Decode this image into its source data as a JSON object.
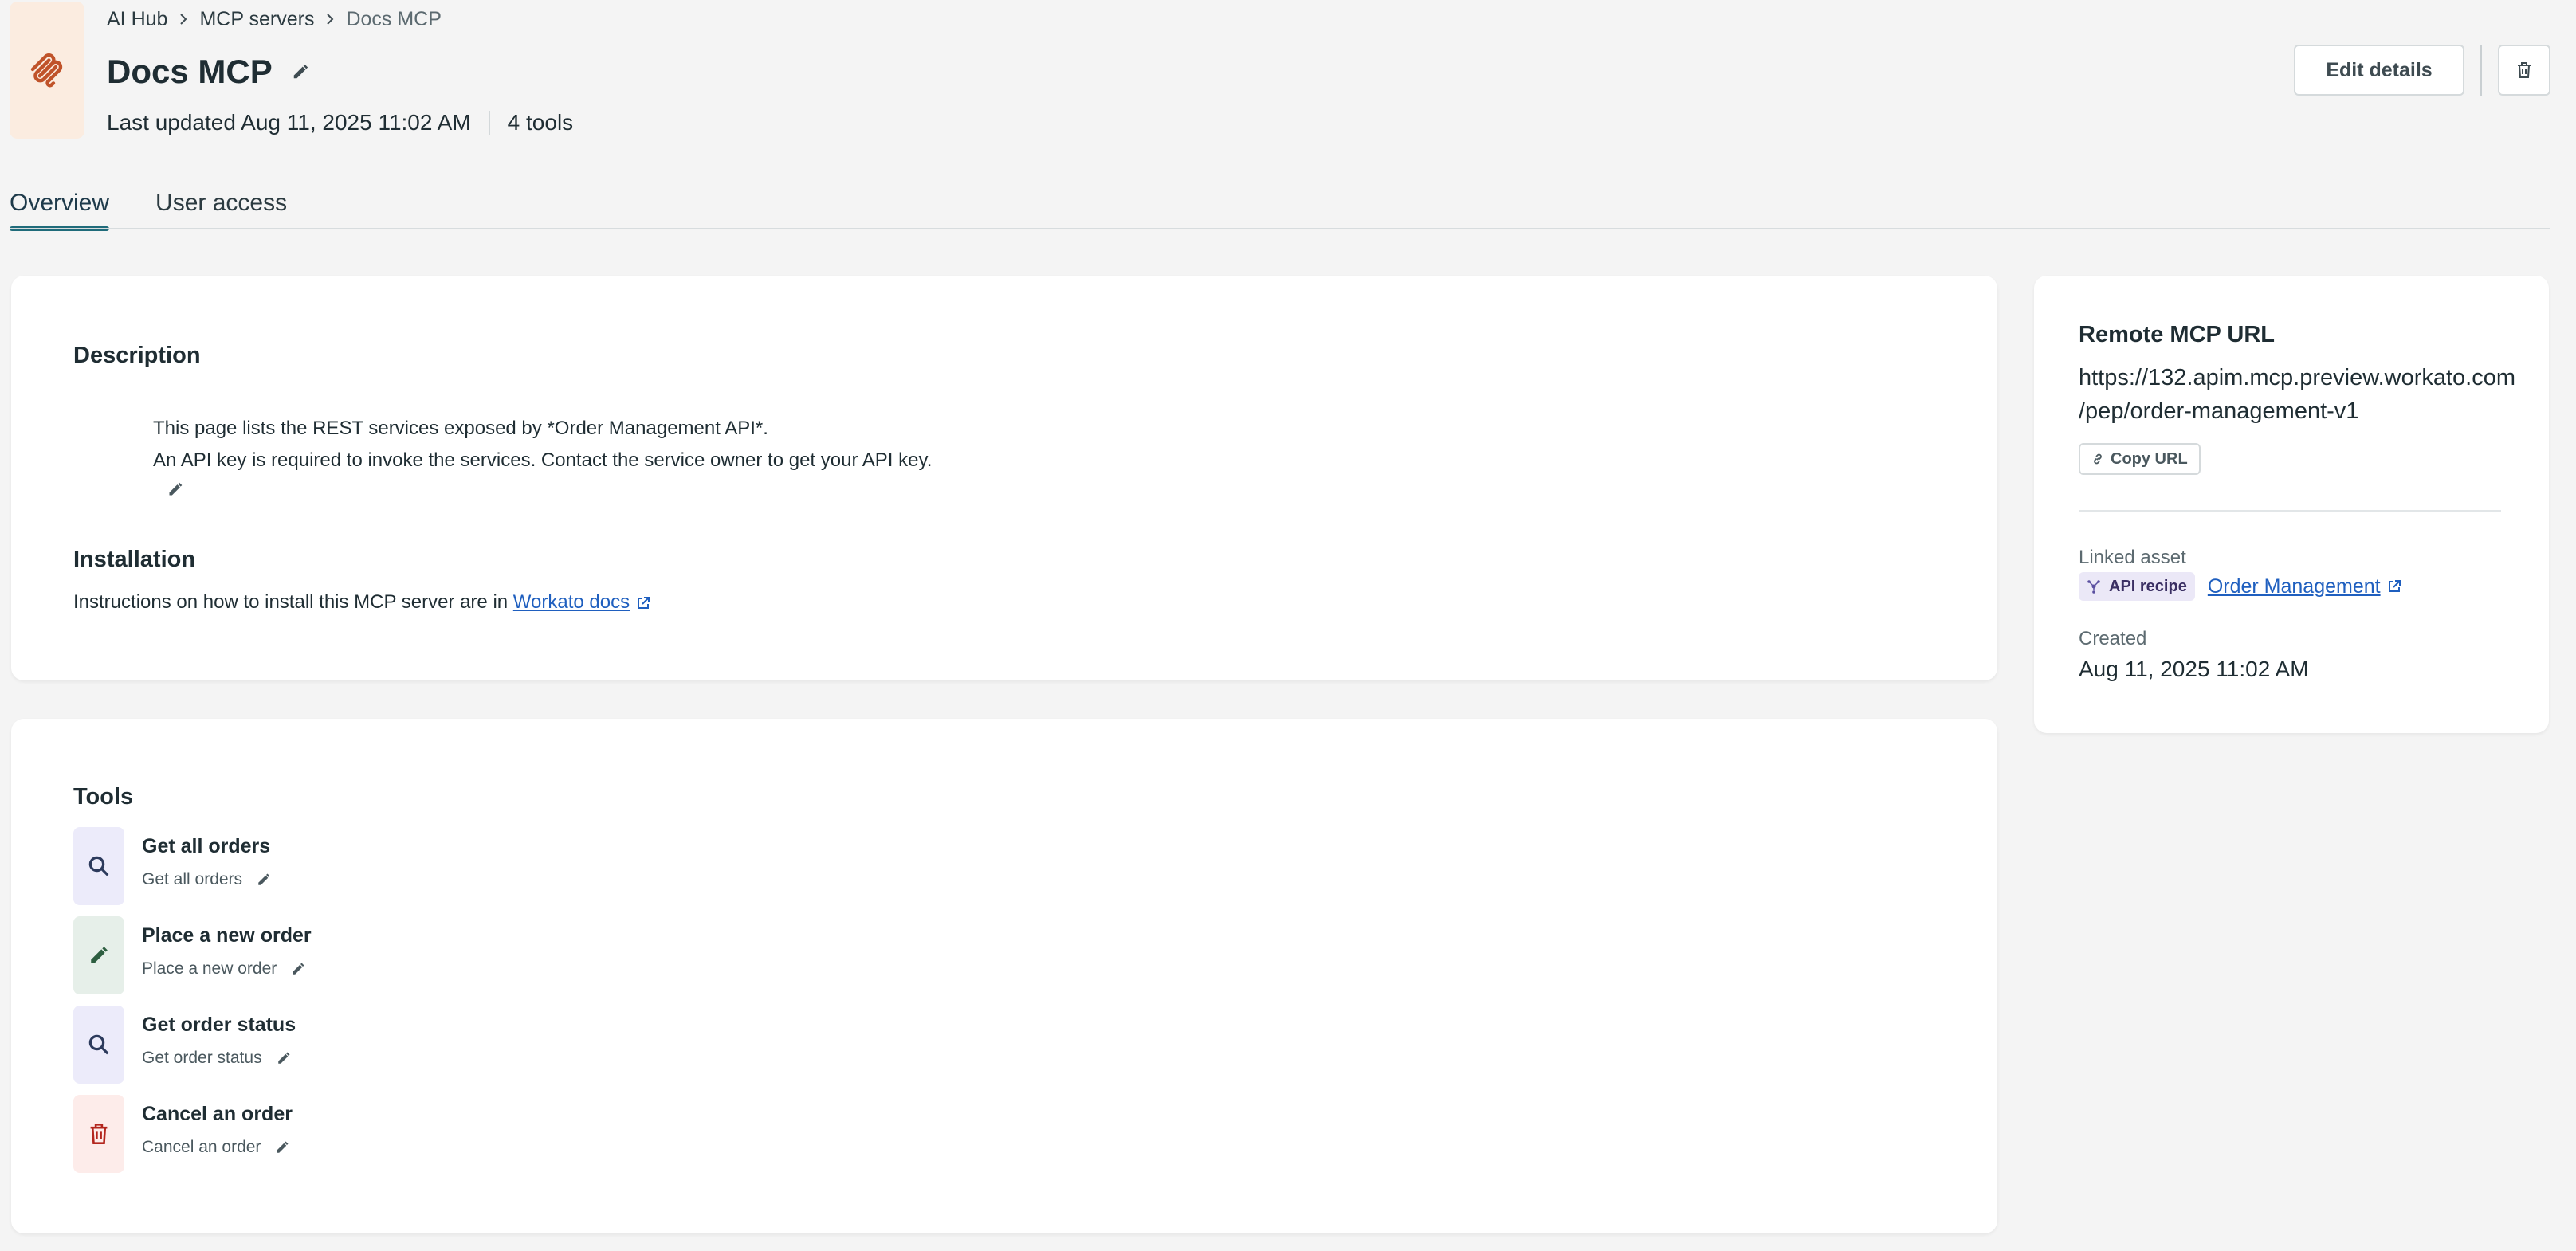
{
  "breadcrumb": {
    "item1": "AI Hub",
    "item2": "MCP servers",
    "current": "Docs MCP"
  },
  "page": {
    "title": "Docs MCP",
    "last_updated": "Last updated Aug 11, 2025 11:02 AM",
    "tools_count": "4 tools",
    "icon": "mcp-icon",
    "icon_color": "#c0532a"
  },
  "actions": {
    "edit_label": "Edit details",
    "delete_icon": "trash-icon"
  },
  "tabs": [
    {
      "label": "Overview",
      "active": true
    },
    {
      "label": "User access",
      "active": false
    }
  ],
  "overview": {
    "description_heading": "Description",
    "description_lines": [
      "This page lists the REST services exposed by *Order Management API*.",
      "An API key is required to invoke the services. Contact the service owner to get your API key."
    ],
    "installation_heading": "Installation",
    "installation_text": "Instructions on how to install this MCP server are in",
    "installation_link": "Workato docs"
  },
  "tools": {
    "heading": "Tools",
    "items": [
      {
        "name": "Get all orders",
        "description": "Get all orders",
        "icon": "search-icon",
        "color": "#ecebfa"
      },
      {
        "name": "Place a new order",
        "description": "Place a new order",
        "icon": "pencil-icon",
        "color": "#e6efe9"
      },
      {
        "name": "Get order status",
        "description": "Get order status",
        "icon": "search-icon",
        "color": "#ecebfa"
      },
      {
        "name": "Cancel an order",
        "description": "Cancel an order",
        "icon": "trash-icon",
        "color": "#fdecea"
      }
    ]
  },
  "side": {
    "url_heading": "Remote MCP URL",
    "url_line1": "https://132.apim.mcp.preview.workato.com",
    "url_line2": "/pep/order-management-v1",
    "copy_label": "Copy URL",
    "linked_asset_label": "Linked asset",
    "asset_badge": "API recipe",
    "asset_link": "Order Management",
    "created_label": "Created",
    "created_value": "Aug 11, 2025 11:02 AM"
  }
}
